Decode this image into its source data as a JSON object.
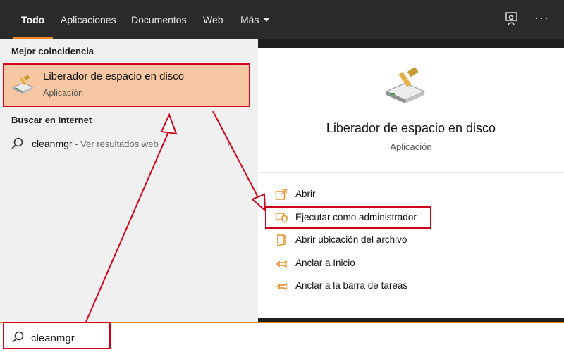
{
  "tabs": [
    {
      "label": "Todo",
      "active": true
    },
    {
      "label": "Aplicaciones"
    },
    {
      "label": "Documentos"
    },
    {
      "label": "Web"
    },
    {
      "label": "Más"
    }
  ],
  "header_icons": {
    "feedback": "feedback-icon",
    "more": "more-options-icon"
  },
  "results": {
    "best_match_heading": "Mejor coincidencia",
    "best_match": {
      "title": "Liberador de espacio en disco",
      "subtitle": "Aplicación",
      "icon": "disk-cleanup-icon"
    },
    "web_heading": "Buscar en Internet",
    "web_result": {
      "query": "cleanmgr",
      "suffix": " - Ver resultados web"
    }
  },
  "preview": {
    "title": "Liberador de espacio en disco",
    "subtitle": "Aplicación",
    "actions": [
      {
        "label": "Abrir",
        "icon": "open-icon"
      },
      {
        "label": "Ejecutar como administrador",
        "icon": "shield-icon"
      },
      {
        "label": "Abrir ubicación del archivo",
        "icon": "file-location-icon"
      },
      {
        "label": "Anclar a Inicio",
        "icon": "pin-icon"
      },
      {
        "label": "Anclar a la barra de tareas",
        "icon": "pin-icon"
      }
    ]
  },
  "search": {
    "value": "cleanmgr"
  },
  "colors": {
    "accent": "#f08a24",
    "annotation": "#d0021b",
    "selection": "#f6c7a2"
  }
}
